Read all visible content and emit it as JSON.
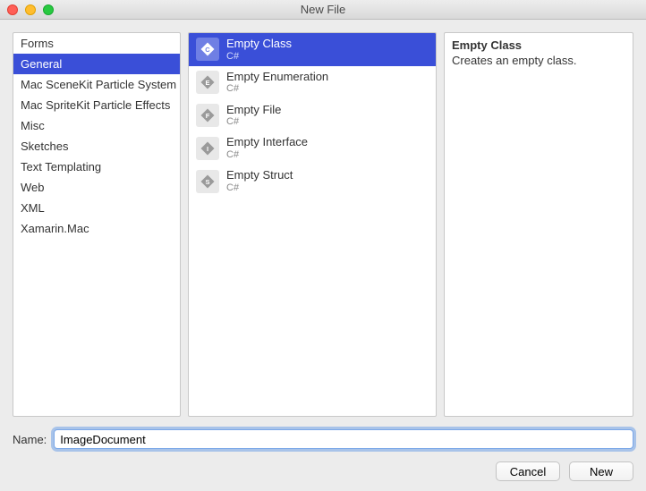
{
  "window": {
    "title": "New File"
  },
  "categories": [
    {
      "label": "Forms",
      "selected": false
    },
    {
      "label": "General",
      "selected": true
    },
    {
      "label": "Mac SceneKit Particle System",
      "selected": false
    },
    {
      "label": "Mac SpriteKit Particle Effects",
      "selected": false
    },
    {
      "label": "Misc",
      "selected": false
    },
    {
      "label": "Sketches",
      "selected": false
    },
    {
      "label": "Text Templating",
      "selected": false
    },
    {
      "label": "Web",
      "selected": false
    },
    {
      "label": "XML",
      "selected": false
    },
    {
      "label": "Xamarin.Mac",
      "selected": false
    }
  ],
  "templates": [
    {
      "label": "Empty Class",
      "sub": "C#",
      "icon": "C",
      "selected": true
    },
    {
      "label": "Empty Enumeration",
      "sub": "C#",
      "icon": "E",
      "selected": false
    },
    {
      "label": "Empty File",
      "sub": "C#",
      "icon": "F",
      "selected": false
    },
    {
      "label": "Empty Interface",
      "sub": "C#",
      "icon": "I",
      "selected": false
    },
    {
      "label": "Empty Struct",
      "sub": "C#",
      "icon": "S",
      "selected": false
    }
  ],
  "description": {
    "title": "Empty Class",
    "body": "Creates an empty class."
  },
  "name_field": {
    "label": "Name:",
    "value": "ImageDocument"
  },
  "buttons": {
    "cancel": "Cancel",
    "new": "New"
  }
}
